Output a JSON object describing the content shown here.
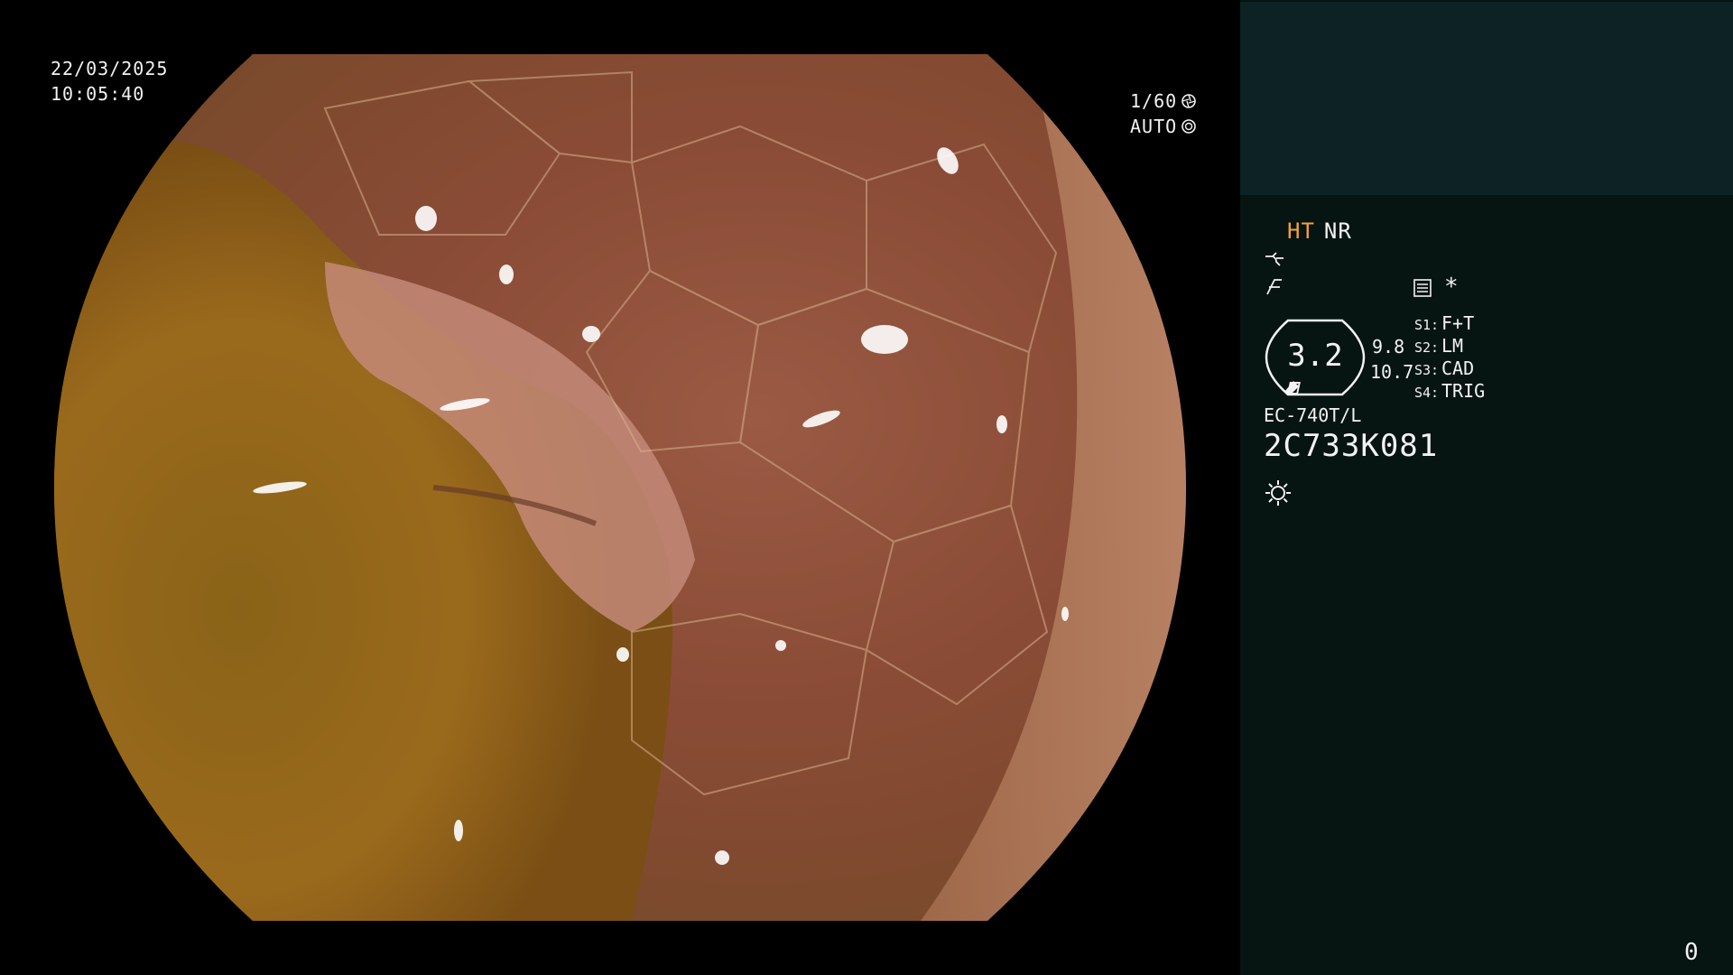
{
  "video": {
    "date": "22/03/2025",
    "time": "10:05:40",
    "shutter": "1/60",
    "iris_mode": "AUTO"
  },
  "panel": {
    "mode_ht": "HT",
    "mode_nr": "NR",
    "zoom": "3.2",
    "zoom_upper": "9.8",
    "zoom_lower": "10.7",
    "switches": [
      {
        "key": "S1:",
        "value": "F+T"
      },
      {
        "key": "S2:",
        "value": "LM"
      },
      {
        "key": "S3:",
        "value": "CAD"
      },
      {
        "key": "S4:",
        "value": "TRIG"
      }
    ],
    "scope_model": "EC-740T/L",
    "scope_serial": "2C733K081",
    "star": "*",
    "frame_counter": "0"
  },
  "icons": [
    "shutter-icon",
    "iris-icon",
    "tone-curve-icon",
    "enhance-icon",
    "menu-icon",
    "zoom-badge-icon",
    "light-icon"
  ],
  "colors": {
    "panel_bg": "#061412",
    "panel_top_bg": "#0c2224",
    "accent_ht": "#f2a23a",
    "text": "#f2f2f2"
  }
}
